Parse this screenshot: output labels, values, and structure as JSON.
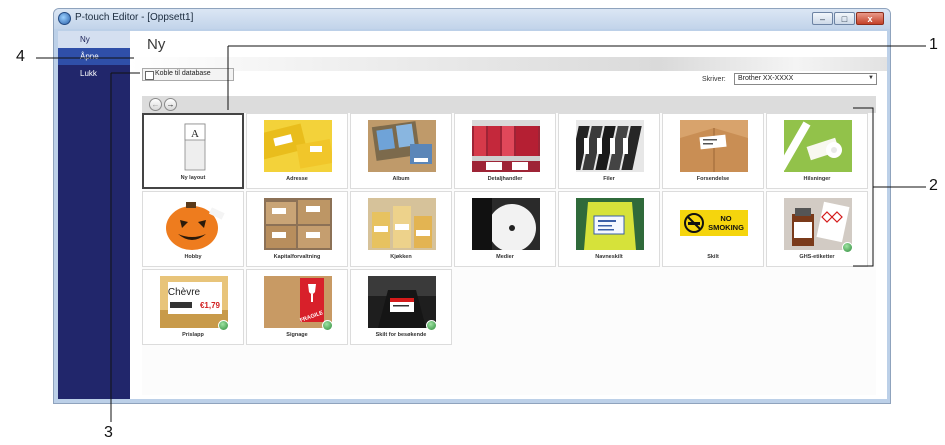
{
  "window": {
    "title": "P-touch Editor - [Oppsett1]",
    "controls": {
      "minimize": "–",
      "maximize": "□",
      "close": "x"
    }
  },
  "sidebar": {
    "items": [
      {
        "label": "Ny",
        "state": "active"
      },
      {
        "label": "Åpne",
        "state": "hover"
      },
      {
        "label": "Lukk",
        "state": "normal"
      }
    ]
  },
  "main": {
    "title": "Ny",
    "database_checkbox": {
      "label": "Koble til database",
      "checked": false
    },
    "printer": {
      "label": "Skriver:",
      "value": "Brother XX-XXXX"
    },
    "nav": {
      "back": "←",
      "forward": "→"
    }
  },
  "templates": [
    {
      "label": "Ny layout",
      "selected": true,
      "thumb": "new-layout",
      "badge": false
    },
    {
      "label": "Adresse",
      "thumb": "address",
      "badge": false
    },
    {
      "label": "Album",
      "thumb": "album",
      "badge": false
    },
    {
      "label": "Detaljhandler",
      "thumb": "retail",
      "badge": false
    },
    {
      "label": "Filer",
      "thumb": "files",
      "badge": false
    },
    {
      "label": "Forsendelse",
      "thumb": "shipping",
      "badge": false
    },
    {
      "label": "Hilsninger",
      "thumb": "greetings",
      "badge": false
    },
    {
      "label": "Hobby",
      "thumb": "hobby",
      "badge": false
    },
    {
      "label": "Kapitalforvaltning",
      "thumb": "assets",
      "badge": false
    },
    {
      "label": "Kjøkken",
      "thumb": "kitchen",
      "badge": false
    },
    {
      "label": "Medier",
      "thumb": "media",
      "badge": false
    },
    {
      "label": "Navneskilt",
      "thumb": "nametag",
      "badge": false
    },
    {
      "label": "Skilt",
      "thumb": "sign",
      "badge": false,
      "sign_text": [
        "NO",
        "SMOKING"
      ]
    },
    {
      "label": "GHS-etiketter",
      "thumb": "ghs",
      "badge": true
    },
    {
      "label": "Prislapp",
      "thumb": "price",
      "badge": true,
      "price_text": [
        "Chèvre",
        "€1,79"
      ]
    },
    {
      "label": "Signage",
      "thumb": "signage",
      "badge": true,
      "signage_text": "FRAGILE"
    },
    {
      "label": "Skilt for besøkende",
      "thumb": "visitor",
      "badge": true
    }
  ],
  "callouts": [
    "1",
    "2",
    "3",
    "4"
  ],
  "colors": {
    "sidebar": "#21266b",
    "active_item": "#d4dff0",
    "hover_item": "#2f4fa8",
    "window_frame": "#bcd0e8"
  }
}
